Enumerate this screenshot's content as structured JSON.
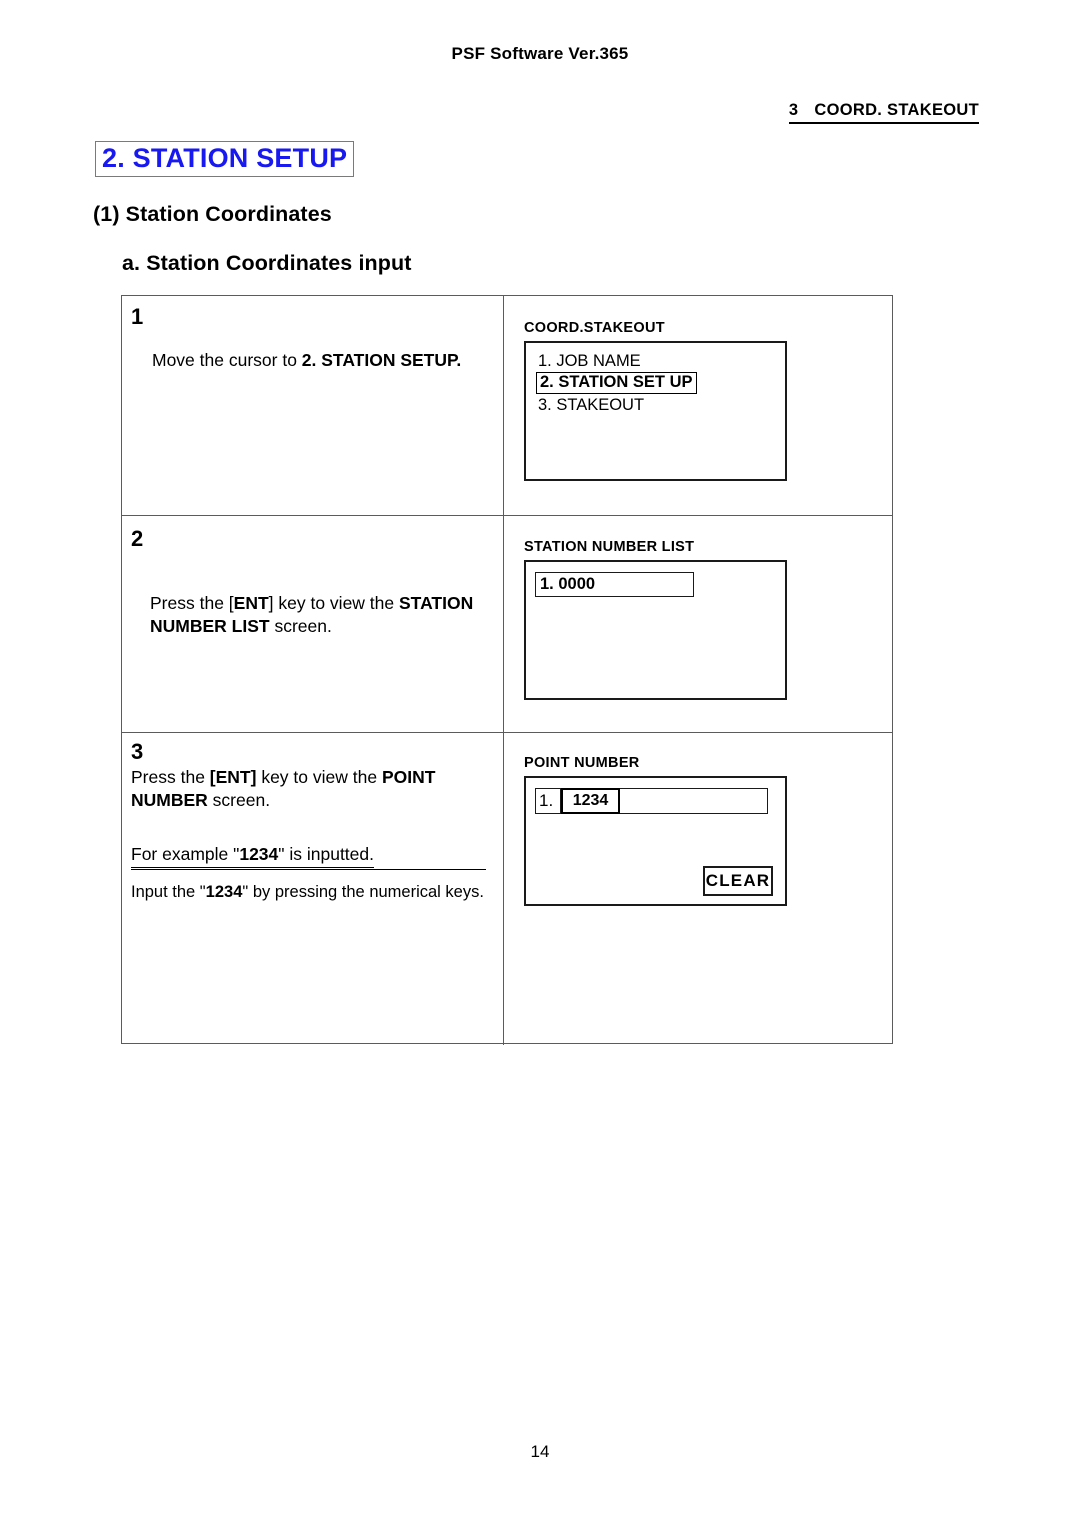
{
  "header": {
    "doc_title": "PSF Software Ver.365",
    "section_number": "3",
    "section_name": "COORD. STAKEOUT"
  },
  "titles": {
    "chapter": "2. STATION SETUP",
    "chapter_color": "#1818f0",
    "subsection": "(1) Station Coordinates",
    "subsubsection": "a. Station Coordinates input"
  },
  "steps": [
    {
      "number": "1",
      "instruction_plain": "Move the cursor to 2. STATION SETUP.",
      "instruction_pre": "Move the cursor to ",
      "instruction_bold": "2. STATION SETUP.",
      "screen": {
        "title": "COORD.STAKEOUT",
        "lines": [
          {
            "text": "1. JOB NAME",
            "selected": false
          },
          {
            "text": "2. STATION SET UP",
            "selected": true
          },
          {
            "text": "3. STAKEOUT",
            "selected": false
          }
        ]
      }
    },
    {
      "number": "2",
      "instruction_pre": "Press the [",
      "instruction_key": "ENT",
      "instruction_mid": "] key to view the ",
      "instruction_bold": "STATION NUMBER LIST",
      "instruction_post": " screen.",
      "screen": {
        "title": "STATION NUMBER LIST",
        "field_value": "1. 0000"
      }
    },
    {
      "number": "3",
      "instruction_pre": "Press the ",
      "instruction_key": "[ENT]",
      "instruction_mid": " key to view the ",
      "instruction_bold": "POINT NUMBER",
      "instruction_post": " screen.",
      "example_pre": "For example \"",
      "example_value": "1234",
      "example_post": "\" is inputted.",
      "note_pre": "Input the \"",
      "note_value": "1234",
      "note_post": "\" by pressing the numerical keys.",
      "screen": {
        "title": "POINT NUMBER",
        "index_label": "1.",
        "input_value": "1234",
        "clear_label": "CLEAR"
      }
    }
  ],
  "footer": {
    "page_number": "14"
  }
}
